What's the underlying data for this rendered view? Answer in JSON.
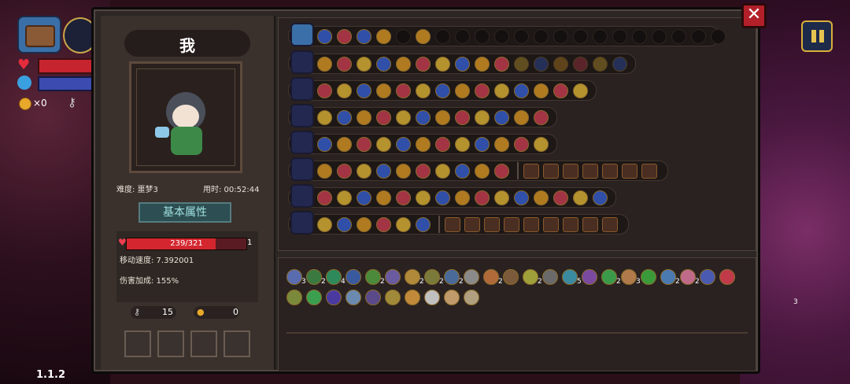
{
  "hud": {
    "coins": "×0",
    "version": "1.1.2"
  },
  "panel": {
    "close_label": "✕",
    "player_name": "我",
    "difficulty": "难度: 噩梦3",
    "time": "用时: 00:52:44",
    "tab": "基本属性",
    "hp": "239/321",
    "hp_fraction": 0.745,
    "hp_extra": "1",
    "move_speed": "移动速度: 7.392001",
    "damage_bonus": "伤害加成: 155%",
    "keys": "15",
    "gold": "0"
  },
  "weapons": [
    {
      "name": "staff-1",
      "slots": 16,
      "filled": 14,
      "style": "mixed"
    },
    {
      "name": "sword-1",
      "slots": 14,
      "filled": 14,
      "style": "mixed"
    },
    {
      "name": "sword-2",
      "slots": 12,
      "filled": 12,
      "style": "mixed"
    },
    {
      "name": "sword-3",
      "slots": 12,
      "filled": 12,
      "style": "mixed"
    },
    {
      "name": "spear",
      "slots": 10,
      "filled": 10,
      "style": "mixed",
      "extra_squares": 7
    },
    {
      "name": "orb",
      "slots": 15,
      "filled": 15,
      "style": "mixed"
    },
    {
      "name": "shield",
      "slots": 6,
      "filled": 6,
      "style": "mixed",
      "extra_squares": 9
    }
  ],
  "inventory_numbers": [
    "3",
    "2",
    "4",
    "2",
    "2",
    "2",
    "2",
    "2",
    "2",
    "5",
    "2",
    "3",
    "2",
    "2",
    "3"
  ]
}
